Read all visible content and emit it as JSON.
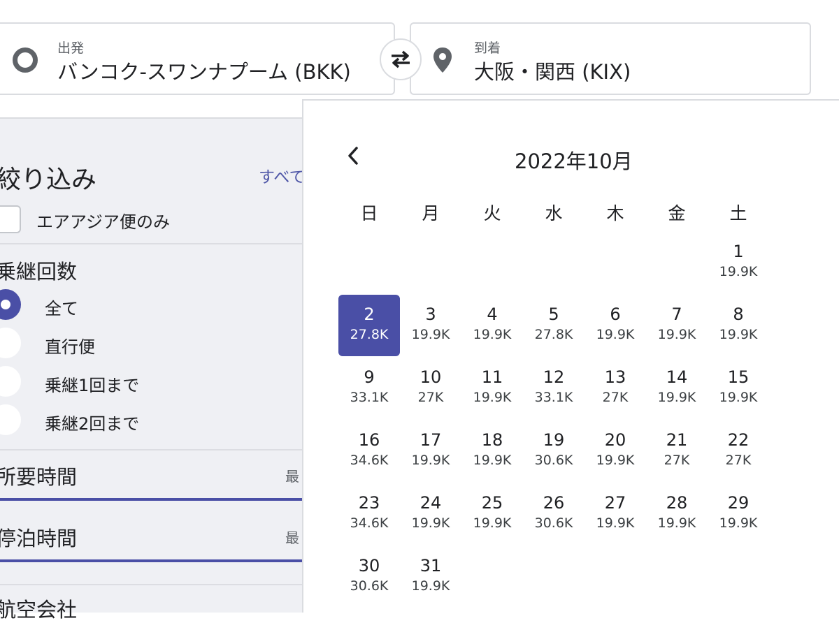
{
  "search": {
    "origin_label": "出発",
    "origin_value": "バンコク-スワンナプーム (BKK)",
    "dest_label": "到着",
    "dest_value": "大阪・関西 (KIX)"
  },
  "filters": {
    "title": "絞り込み",
    "clear_all": "すべて",
    "airasia_only": "エアアジア便のみ",
    "stops_title": "乗継回数",
    "stops_options": [
      "全て",
      "直行便",
      "乗継1回まで",
      "乗継2回まで"
    ],
    "selected_stop": 0,
    "duration_title": "所要時間",
    "duration_hint": "最",
    "layover_title": "停泊時間",
    "layover_hint": "最",
    "airline_title": "航空会社"
  },
  "calendar": {
    "month_title": "2022年10月",
    "weekdays": [
      "日",
      "月",
      "火",
      "水",
      "木",
      "金",
      "土"
    ],
    "first_weekday": 6,
    "selected_day": 2,
    "days": [
      {
        "day": "1",
        "price": "19.9K"
      },
      {
        "day": "2",
        "price": "27.8K"
      },
      {
        "day": "3",
        "price": "19.9K"
      },
      {
        "day": "4",
        "price": "19.9K"
      },
      {
        "day": "5",
        "price": "27.8K"
      },
      {
        "day": "6",
        "price": "19.9K"
      },
      {
        "day": "7",
        "price": "19.9K"
      },
      {
        "day": "8",
        "price": "19.9K"
      },
      {
        "day": "9",
        "price": "33.1K"
      },
      {
        "day": "10",
        "price": "27K"
      },
      {
        "day": "11",
        "price": "19.9K"
      },
      {
        "day": "12",
        "price": "33.1K"
      },
      {
        "day": "13",
        "price": "27K"
      },
      {
        "day": "14",
        "price": "19.9K"
      },
      {
        "day": "15",
        "price": "19.9K"
      },
      {
        "day": "16",
        "price": "34.6K"
      },
      {
        "day": "17",
        "price": "19.9K"
      },
      {
        "day": "18",
        "price": "19.9K"
      },
      {
        "day": "19",
        "price": "30.6K"
      },
      {
        "day": "20",
        "price": "19.9K"
      },
      {
        "day": "21",
        "price": "27K"
      },
      {
        "day": "22",
        "price": "27K"
      },
      {
        "day": "23",
        "price": "34.6K"
      },
      {
        "day": "24",
        "price": "19.9K"
      },
      {
        "day": "25",
        "price": "19.9K"
      },
      {
        "day": "26",
        "price": "30.6K"
      },
      {
        "day": "27",
        "price": "19.9K"
      },
      {
        "day": "28",
        "price": "19.9K"
      },
      {
        "day": "29",
        "price": "19.9K"
      },
      {
        "day": "30",
        "price": "30.6K"
      },
      {
        "day": "31",
        "price": "19.9K"
      }
    ]
  },
  "colors": {
    "accent": "#4a4fa6",
    "filter_bg": "#eff0f4",
    "border": "#dadce0"
  },
  "icons": {
    "origin": "origin-circle-icon",
    "destination": "location-pin-icon",
    "swap": "swap-arrows-icon",
    "prev": "chevron-left-icon"
  }
}
